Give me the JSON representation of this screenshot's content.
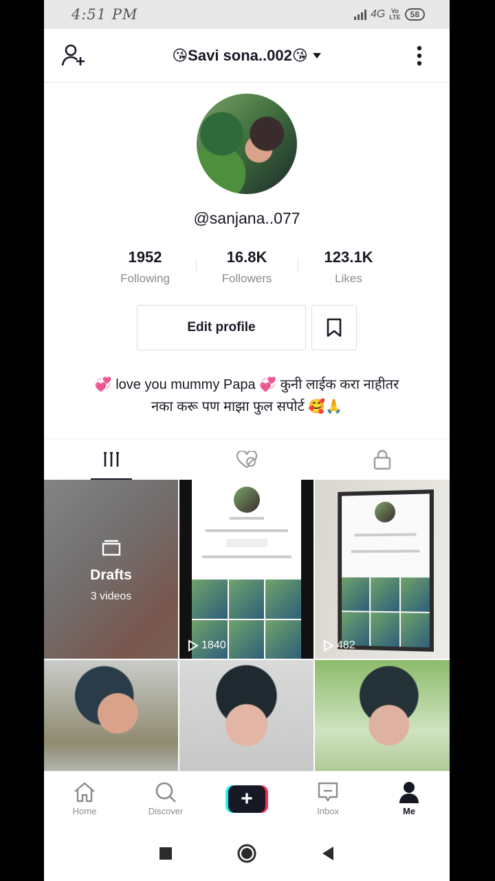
{
  "status_bar": {
    "time": "4:51 PM",
    "network": "4G",
    "lte_top": "Vo",
    "lte_bottom": "LTE",
    "battery": "58"
  },
  "header": {
    "title": "😘Savi sona..002😘"
  },
  "profile": {
    "handle": "@sanjana..077",
    "stats": [
      {
        "value": "1952",
        "label": "Following"
      },
      {
        "value": "16.8K",
        "label": "Followers"
      },
      {
        "value": "123.1K",
        "label": "Likes"
      }
    ],
    "edit_label": "Edit profile",
    "bio_line1": "💞 love you mummy Papa 💞 कुनी लाईक करा नाहीतर",
    "bio_line2": "नका करू पण माझा फुल सपोर्ट 🥰🙏"
  },
  "grid": {
    "drafts_title": "Drafts",
    "drafts_count": "3 videos",
    "videos": [
      {
        "plays": "1840"
      },
      {
        "plays": "482"
      }
    ]
  },
  "bottom_nav": {
    "home": "Home",
    "discover": "Discover",
    "inbox": "Inbox",
    "me": "Me"
  },
  "colors": {
    "accent_red": "#fe2c55",
    "accent_cyan": "#25f4ee",
    "text": "#161823"
  }
}
